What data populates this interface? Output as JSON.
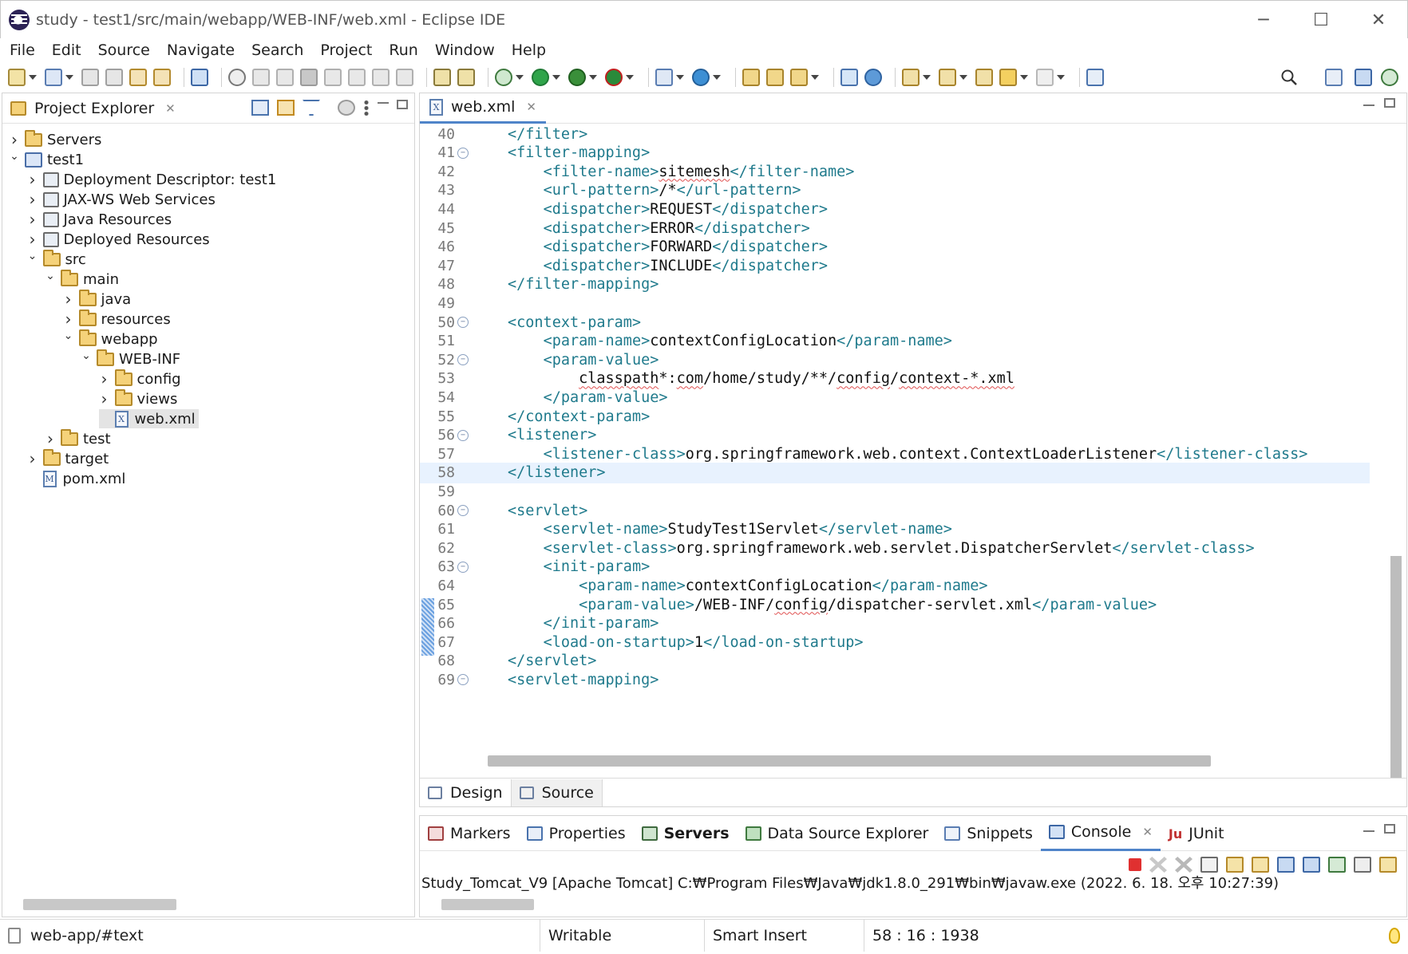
{
  "window": {
    "title": "study - test1/src/main/webapp/WEB-INF/web.xml - Eclipse IDE",
    "controls": {
      "minimize": "─",
      "maximize": "☐",
      "close": "✕"
    }
  },
  "menu": [
    "File",
    "Edit",
    "Source",
    "Navigate",
    "Search",
    "Project",
    "Run",
    "Window",
    "Help"
  ],
  "project_explorer": {
    "title": "Project Explorer",
    "tree": [
      {
        "label": "Servers",
        "depth": 0,
        "expanded": false,
        "icon": "servers-folder-icon"
      },
      {
        "label": "test1",
        "depth": 0,
        "expanded": true,
        "icon": "maven-project-icon"
      },
      {
        "label": "Deployment Descriptor: test1",
        "depth": 1,
        "expanded": false,
        "icon": "deployment-descriptor-icon"
      },
      {
        "label": "JAX-WS Web Services",
        "depth": 1,
        "expanded": false,
        "icon": "web-services-icon"
      },
      {
        "label": "Java Resources",
        "depth": 1,
        "expanded": false,
        "icon": "java-resources-icon"
      },
      {
        "label": "Deployed Resources",
        "depth": 1,
        "expanded": false,
        "icon": "deployed-resources-icon"
      },
      {
        "label": "src",
        "depth": 1,
        "expanded": true,
        "icon": "folder-icon"
      },
      {
        "label": "main",
        "depth": 2,
        "expanded": true,
        "icon": "folder-icon"
      },
      {
        "label": "java",
        "depth": 3,
        "expanded": false,
        "icon": "folder-icon"
      },
      {
        "label": "resources",
        "depth": 3,
        "expanded": false,
        "icon": "folder-icon"
      },
      {
        "label": "webapp",
        "depth": 3,
        "expanded": true,
        "icon": "folder-icon"
      },
      {
        "label": "WEB-INF",
        "depth": 4,
        "expanded": true,
        "icon": "folder-icon"
      },
      {
        "label": "config",
        "depth": 5,
        "expanded": false,
        "icon": "folder-icon"
      },
      {
        "label": "views",
        "depth": 5,
        "expanded": false,
        "icon": "folder-icon"
      },
      {
        "label": "web.xml",
        "depth": 5,
        "expanded": null,
        "icon": "xml-file-icon",
        "selected": true
      },
      {
        "label": "test",
        "depth": 2,
        "expanded": false,
        "icon": "folder-icon"
      },
      {
        "label": "target",
        "depth": 1,
        "expanded": false,
        "icon": "folder-icon"
      },
      {
        "label": "pom.xml",
        "depth": 1,
        "expanded": null,
        "icon": "maven-pom-icon"
      }
    ]
  },
  "editor": {
    "tab": "web.xml",
    "current_line": 58,
    "lines": [
      {
        "n": "40",
        "fold": false,
        "indent": 1,
        "parts": [
          [
            "t",
            "</filter>"
          ]
        ]
      },
      {
        "n": "41",
        "fold": true,
        "indent": 1,
        "parts": [
          [
            "t",
            "<filter-mapping>"
          ]
        ]
      },
      {
        "n": "42",
        "fold": false,
        "indent": 2,
        "parts": [
          [
            "t",
            "<filter-name>"
          ],
          [
            "u",
            "sitemesh"
          ],
          [
            "t",
            "</filter-name>"
          ]
        ]
      },
      {
        "n": "43",
        "fold": false,
        "indent": 2,
        "parts": [
          [
            "t",
            "<url-pattern>"
          ],
          [
            "x",
            "/*"
          ],
          [
            "t",
            "</url-pattern>"
          ]
        ]
      },
      {
        "n": "44",
        "fold": false,
        "indent": 2,
        "parts": [
          [
            "t",
            "<dispatcher>"
          ],
          [
            "x",
            "REQUEST"
          ],
          [
            "t",
            "</dispatcher>"
          ]
        ]
      },
      {
        "n": "45",
        "fold": false,
        "indent": 2,
        "parts": [
          [
            "t",
            "<dispatcher>"
          ],
          [
            "x",
            "ERROR"
          ],
          [
            "t",
            "</dispatcher>"
          ]
        ]
      },
      {
        "n": "46",
        "fold": false,
        "indent": 2,
        "parts": [
          [
            "t",
            "<dispatcher>"
          ],
          [
            "x",
            "FORWARD"
          ],
          [
            "t",
            "</dispatcher>"
          ]
        ]
      },
      {
        "n": "47",
        "fold": false,
        "indent": 2,
        "parts": [
          [
            "t",
            "<dispatcher>"
          ],
          [
            "x",
            "INCLUDE"
          ],
          [
            "t",
            "</dispatcher>"
          ]
        ]
      },
      {
        "n": "48",
        "fold": false,
        "indent": 1,
        "parts": [
          [
            "t",
            "</filter-mapping>"
          ]
        ]
      },
      {
        "n": "49",
        "fold": false,
        "indent": 0,
        "parts": []
      },
      {
        "n": "50",
        "fold": true,
        "indent": 1,
        "parts": [
          [
            "t",
            "<context-param>"
          ]
        ]
      },
      {
        "n": "51",
        "fold": false,
        "indent": 2,
        "parts": [
          [
            "t",
            "<param-name>"
          ],
          [
            "x",
            "contextConfigLocation"
          ],
          [
            "t",
            "</param-name>"
          ]
        ]
      },
      {
        "n": "52",
        "fold": true,
        "indent": 2,
        "parts": [
          [
            "t",
            "<param-value>"
          ]
        ]
      },
      {
        "n": "53",
        "fold": false,
        "indent": 3,
        "parts": [
          [
            "u",
            "classpath"
          ],
          [
            "x",
            "*:"
          ],
          [
            "u",
            "com"
          ],
          [
            "x",
            "/home/study/**/"
          ],
          [
            "u",
            "config"
          ],
          [
            "x",
            "/"
          ],
          [
            "u",
            "context-*.xml"
          ]
        ]
      },
      {
        "n": "54",
        "fold": false,
        "indent": 2,
        "parts": [
          [
            "t",
            "</param-value>"
          ]
        ]
      },
      {
        "n": "55",
        "fold": false,
        "indent": 1,
        "parts": [
          [
            "t",
            "</context-param>"
          ]
        ]
      },
      {
        "n": "56",
        "fold": true,
        "indent": 1,
        "parts": [
          [
            "t",
            "<listener>"
          ]
        ]
      },
      {
        "n": "57",
        "fold": false,
        "indent": 2,
        "parts": [
          [
            "t",
            "<listener-class>"
          ],
          [
            "x",
            "org.springframework.web.context.ContextLoaderListener"
          ],
          [
            "t",
            "</listener-class>"
          ]
        ]
      },
      {
        "n": "58",
        "fold": false,
        "indent": 1,
        "parts": [
          [
            "t",
            "</listener>"
          ]
        ]
      },
      {
        "n": "59",
        "fold": false,
        "indent": 0,
        "parts": []
      },
      {
        "n": "60",
        "fold": true,
        "indent": 1,
        "parts": [
          [
            "t",
            "<servlet>"
          ]
        ]
      },
      {
        "n": "61",
        "fold": false,
        "indent": 2,
        "parts": [
          [
            "t",
            "<servlet-name>"
          ],
          [
            "x",
            "StudyTest1Servlet"
          ],
          [
            "t",
            "</servlet-name>"
          ]
        ]
      },
      {
        "n": "62",
        "fold": false,
        "indent": 2,
        "parts": [
          [
            "t",
            "<servlet-class>"
          ],
          [
            "x",
            "org.springframework.web.servlet.DispatcherServlet"
          ],
          [
            "t",
            "</servlet-class>"
          ]
        ]
      },
      {
        "n": "63",
        "fold": true,
        "indent": 2,
        "parts": [
          [
            "t",
            "<init-param>"
          ]
        ]
      },
      {
        "n": "64",
        "fold": false,
        "indent": 3,
        "parts": [
          [
            "t",
            "<param-name>"
          ],
          [
            "x",
            "contextConfigLocation"
          ],
          [
            "t",
            "</param-name>"
          ]
        ]
      },
      {
        "n": "65",
        "fold": false,
        "indent": 3,
        "parts": [
          [
            "t",
            "<param-value>"
          ],
          [
            "x",
            "/WEB-INF/"
          ],
          [
            "u",
            "config"
          ],
          [
            "x",
            "/dispatcher-servlet.xml"
          ],
          [
            "t",
            "</param-value>"
          ]
        ]
      },
      {
        "n": "66",
        "fold": false,
        "indent": 2,
        "parts": [
          [
            "t",
            "</init-param>"
          ]
        ]
      },
      {
        "n": "67",
        "fold": false,
        "indent": 2,
        "parts": [
          [
            "t",
            "<load-on-startup>"
          ],
          [
            "x",
            "1"
          ],
          [
            "t",
            "</load-on-startup>"
          ]
        ]
      },
      {
        "n": "68",
        "fold": false,
        "indent": 1,
        "parts": [
          [
            "t",
            "</servlet>"
          ]
        ]
      },
      {
        "n": "69",
        "fold": true,
        "indent": 1,
        "parts": [
          [
            "t",
            "<servlet-mapping>"
          ]
        ]
      }
    ],
    "bottom_tabs": [
      {
        "label": "Design",
        "icon": "design-icon",
        "active": false
      },
      {
        "label": "Source",
        "icon": "source-icon",
        "active": true
      }
    ]
  },
  "console": {
    "tabs": [
      {
        "label": "Markers",
        "icon": "markers-icon",
        "bold": false,
        "active": false
      },
      {
        "label": "Properties",
        "icon": "properties-icon",
        "bold": false,
        "active": false
      },
      {
        "label": "Servers",
        "icon": "servers-icon",
        "bold": true,
        "active": false
      },
      {
        "label": "Data Source Explorer",
        "icon": "data-source-icon",
        "bold": false,
        "active": false
      },
      {
        "label": "Snippets",
        "icon": "snippets-icon",
        "bold": false,
        "active": false
      },
      {
        "label": "Console",
        "icon": "console-icon",
        "bold": false,
        "active": true
      },
      {
        "label": "JUnit",
        "icon": "junit-icon",
        "bold": false,
        "active": false
      }
    ],
    "line": "Study_Tomcat_V9 [Apache Tomcat] C:₩Program Files₩Java₩jdk1.8.0_291₩bin₩javaw.exe  (2022. 6. 18. 오후 10:27:39)"
  },
  "statusbar": {
    "path": "web-app/#text",
    "writable": "Writable",
    "insert_mode": "Smart Insert",
    "position": "58 : 16 : 1938"
  },
  "colors": {
    "xml_tag": "#1f7a8c",
    "current_line_bg": "#e8f2fe",
    "active_tab_accent": "#4f84c9",
    "spelling_underline": "#e05050"
  }
}
